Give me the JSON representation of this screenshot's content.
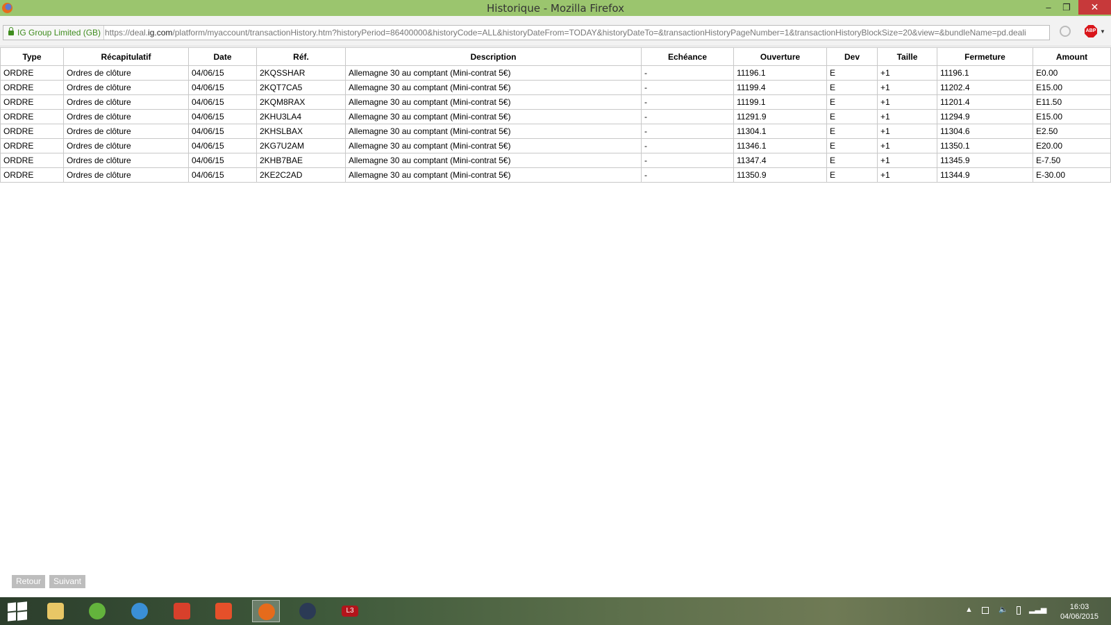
{
  "window": {
    "title": "Historique - Mozilla Firefox",
    "minimize": "–",
    "restore": "❐",
    "close": "✕"
  },
  "address": {
    "identity": "IG Group Limited (GB)",
    "url_prefix": "https://deal.",
    "url_domain": "ig.com",
    "url_rest": "/platform/myaccount/transactionHistory.htm?historyPeriod=86400000&historyCode=ALL&historyDateFrom=TODAY&historyDateTo=&transactionHistoryPageNumber=1&transactionHistoryBlockSize=20&view=&bundleName=pd.deali",
    "abp_label": "ABP"
  },
  "table": {
    "headers": [
      "Type",
      "Récapitulatif",
      "Date",
      "Réf.",
      "Description",
      "Echéance",
      "Ouverture",
      "Dev",
      "Taille",
      "Fermeture",
      "Amount"
    ],
    "rows": [
      [
        "ORDRE",
        "Ordres de clôture",
        "04/06/15",
        "2KQSSHAR",
        "Allemagne 30 au comptant (Mini-contrat 5€)",
        "-",
        "11196.1",
        "E",
        "+1",
        "11196.1",
        "E0.00"
      ],
      [
        "ORDRE",
        "Ordres de clôture",
        "04/06/15",
        "2KQT7CA5",
        "Allemagne 30 au comptant (Mini-contrat 5€)",
        "-",
        "11199.4",
        "E",
        "+1",
        "11202.4",
        "E15.00"
      ],
      [
        "ORDRE",
        "Ordres de clôture",
        "04/06/15",
        "2KQM8RAX",
        "Allemagne 30 au comptant (Mini-contrat 5€)",
        "-",
        "11199.1",
        "E",
        "+1",
        "11201.4",
        "E11.50"
      ],
      [
        "ORDRE",
        "Ordres de clôture",
        "04/06/15",
        "2KHU3LA4",
        "Allemagne 30 au comptant (Mini-contrat 5€)",
        "-",
        "11291.9",
        "E",
        "+1",
        "11294.9",
        "E15.00"
      ],
      [
        "ORDRE",
        "Ordres de clôture",
        "04/06/15",
        "2KHSLBAX",
        "Allemagne 30 au comptant (Mini-contrat 5€)",
        "-",
        "11304.1",
        "E",
        "+1",
        "11304.6",
        "E2.50"
      ],
      [
        "ORDRE",
        "Ordres de clôture",
        "04/06/15",
        "2KG7U2AM",
        "Allemagne 30 au comptant (Mini-contrat 5€)",
        "-",
        "11346.1",
        "E",
        "+1",
        "11350.1",
        "E20.00"
      ],
      [
        "ORDRE",
        "Ordres de clôture",
        "04/06/15",
        "2KHB7BAE",
        "Allemagne 30 au comptant (Mini-contrat 5€)",
        "-",
        "11347.4",
        "E",
        "+1",
        "11345.9",
        "E-7.50"
      ],
      [
        "ORDRE",
        "Ordres de clôture",
        "04/06/15",
        "2KE2C2AD",
        "Allemagne 30 au comptant (Mini-contrat 5€)",
        "-",
        "11350.9",
        "E",
        "+1",
        "11344.9",
        "E-30.00"
      ]
    ]
  },
  "nav": {
    "prev": "Retour",
    "next": "Suivant"
  },
  "taskbar": {
    "apps": [
      {
        "name": "file-explorer",
        "color": "#e8c766"
      },
      {
        "name": "utorrent",
        "color": "#63b33c"
      },
      {
        "name": "thunderbird",
        "color": "#3a8fd6"
      },
      {
        "name": "ccleaner",
        "color": "#d8402b"
      },
      {
        "name": "burner",
        "color": "#e5502a"
      },
      {
        "name": "firefox",
        "color": "#e66b1b"
      },
      {
        "name": "poker",
        "color": "#2b3a55"
      },
      {
        "name": "l3",
        "color": "#b3141b"
      }
    ],
    "l3_label": "L3",
    "time": "16:03",
    "date": "04/06/2015"
  }
}
